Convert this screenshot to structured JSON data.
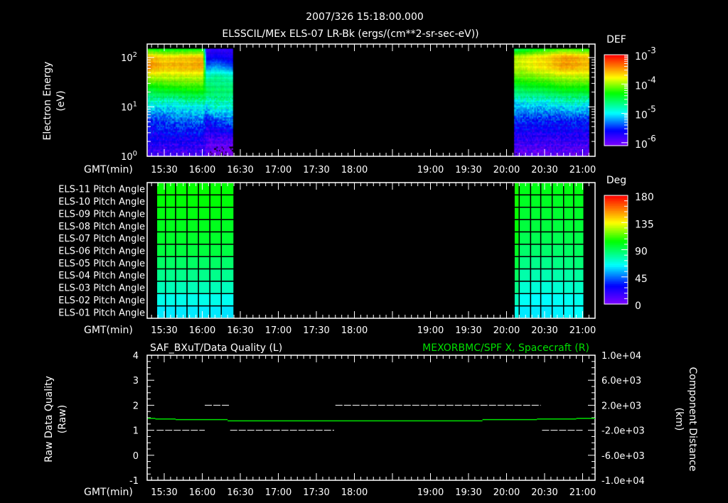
{
  "header": {
    "title": "2007/326 15:18:00.000",
    "subtitle": "ELSSCIL/MEx ELS-07 LR-Bk  (ergs/(cm**2-sr-sec-eV))"
  },
  "colors": {
    "background": "#000000",
    "axes": "#ffffff",
    "spacecraft_x_line": "#00e000",
    "quality_line": "#ffffff"
  },
  "time_axis": {
    "label": "GMT(min)",
    "range": [
      "15:16",
      "21:10"
    ],
    "tick_labels": [
      "15:30",
      "16:00",
      "16:30",
      "17:00",
      "17:30",
      "18:00",
      "19:00",
      "19:30",
      "20:00",
      "20:30",
      "21:00"
    ]
  },
  "chart_data": [
    {
      "type": "heatmap",
      "name": "electron-spectrogram",
      "ylabel": [
        "Electron Energy",
        "(eV)"
      ],
      "yscale": "log",
      "ylim": [
        1,
        190
      ],
      "y_ticks": [
        {
          "base": "10",
          "exp": "2",
          "value": 100
        },
        {
          "base": "10",
          "exp": "1",
          "value": 10
        },
        {
          "base": "10",
          "exp": "0",
          "value": 1
        }
      ],
      "colorbar": {
        "label": "DEF",
        "scale": "log",
        "range_log10": [
          -6.1,
          -3.0
        ],
        "ticks": [
          {
            "base": "10",
            "exp": "-3",
            "value": -3
          },
          {
            "base": "10",
            "exp": "-4",
            "value": -4
          },
          {
            "base": "10",
            "exp": "-5",
            "value": -5
          },
          {
            "base": "10",
            "exp": "-6",
            "value": -6
          }
        ]
      },
      "energy_bins_log10": [
        0,
        0.3,
        0.7,
        1.0,
        1.3,
        1.6,
        1.8,
        2.0,
        2.16
      ],
      "blocks": [
        {
          "start": "15:17",
          "end": "16:24",
          "samples": [
            {
              "time": "15:17",
              "log_def": [
                -5.9,
                -5.7,
                -5.5,
                -5.0,
                -4.5,
                -3.9,
                -3.4,
                -3.6,
                -4.3
              ]
            },
            {
              "time": "15:30",
              "log_def": [
                -5.9,
                -5.7,
                -5.4,
                -5.0,
                -4.4,
                -3.9,
                -3.6,
                -3.7,
                -4.4
              ]
            },
            {
              "time": "16:00",
              "log_def": [
                -5.9,
                -5.7,
                -5.3,
                -4.9,
                -4.3,
                -3.9,
                -3.5,
                -3.6,
                -4.4
              ]
            },
            {
              "time": "16:03",
              "log_def": [
                -6.0,
                -5.9,
                -5.6,
                -5.0,
                -4.5,
                -4.8,
                -5.3,
                -5.7,
                -5.8
              ]
            },
            {
              "time": "16:10",
              "log_def": [
                -6.2,
                -5.9,
                -5.4,
                -4.8,
                -4.6,
                -4.7,
                -5.2,
                -5.6,
                -5.8
              ]
            },
            {
              "time": "16:24",
              "log_def": [
                -6.2,
                -5.9,
                -5.3,
                -4.9,
                -4.6,
                -4.8,
                -5.4,
                -5.7,
                -5.8
              ]
            }
          ]
        },
        {
          "start": "20:06",
          "end": "21:05",
          "samples": [
            {
              "time": "20:06",
              "log_def": [
                -6.0,
                -5.8,
                -5.5,
                -5.1,
                -4.6,
                -4.1,
                -3.9,
                -3.9,
                -4.6
              ]
            },
            {
              "time": "20:30",
              "log_def": [
                -6.0,
                -5.8,
                -5.5,
                -5.1,
                -4.5,
                -4.0,
                -3.7,
                -3.7,
                -4.3
              ]
            },
            {
              "time": "20:45",
              "log_def": [
                -6.0,
                -5.8,
                -5.5,
                -5.0,
                -4.4,
                -3.9,
                -3.5,
                -3.5,
                -4.2
              ]
            },
            {
              "time": "21:05",
              "log_def": [
                -6.0,
                -5.8,
                -5.5,
                -5.0,
                -4.4,
                -3.9,
                -3.6,
                -3.6,
                -4.3
              ]
            }
          ]
        }
      ]
    },
    {
      "type": "heatmap",
      "name": "pitch-angle",
      "rows": [
        "ELS-11 Pitch Angle",
        "ELS-10 Pitch Angle",
        "ELS-09 Pitch Angle",
        "ELS-08 Pitch Angle",
        "ELS-07 Pitch Angle",
        "ELS-06 Pitch Angle",
        "ELS-05 Pitch Angle",
        "ELS-04 Pitch Angle",
        "ELS-03 Pitch Angle",
        "ELS-02 Pitch Angle",
        "ELS-01 Pitch Angle"
      ],
      "colorbar": {
        "label": "Deg",
        "range": [
          0,
          180
        ],
        "ticks": [
          "180",
          "135",
          "90",
          "45",
          "0"
        ]
      },
      "columns": [
        {
          "start": "15:24",
          "end": "15:31",
          "values": [
            105,
            104,
            102,
            100,
            98,
            95,
            89,
            83,
            76,
            68,
            62
          ]
        },
        {
          "start": "15:31",
          "end": "15:39",
          "values": [
            105,
            104,
            102,
            100,
            98,
            95,
            89,
            83,
            76,
            68,
            62
          ]
        },
        {
          "start": "15:39",
          "end": "15:48",
          "values": [
            105,
            104,
            102,
            100,
            98,
            95,
            89,
            83,
            76,
            68,
            62
          ]
        },
        {
          "start": "15:48",
          "end": "15:57",
          "values": [
            105,
            104,
            102,
            100,
            98,
            95,
            89,
            83,
            76,
            68,
            62
          ]
        },
        {
          "start": "15:57",
          "end": "16:06",
          "values": [
            105,
            104,
            102,
            100,
            98,
            95,
            89,
            83,
            76,
            68,
            62
          ]
        },
        {
          "start": "16:06",
          "end": "16:15",
          "values": [
            105,
            104,
            102,
            100,
            98,
            95,
            89,
            83,
            76,
            68,
            62
          ]
        },
        {
          "start": "16:15",
          "end": "16:25",
          "values": [
            104,
            103,
            101,
            99,
            97,
            94,
            88,
            82,
            75,
            67,
            61
          ]
        },
        {
          "start": "20:06",
          "end": "20:10",
          "values": [
            106,
            106,
            105,
            104,
            102,
            99,
            95,
            90,
            84,
            76,
            68
          ]
        },
        {
          "start": "20:10",
          "end": "20:19",
          "values": [
            101,
            99,
            97,
            95,
            92,
            88,
            84,
            78,
            72,
            66,
            62
          ]
        },
        {
          "start": "20:19",
          "end": "20:27",
          "values": [
            101,
            99,
            97,
            95,
            92,
            88,
            83,
            77,
            71,
            65,
            62
          ]
        },
        {
          "start": "20:27",
          "end": "20:36",
          "values": [
            101,
            99,
            97,
            95,
            92,
            88,
            83,
            77,
            71,
            65,
            62
          ]
        },
        {
          "start": "20:36",
          "end": "20:45",
          "values": [
            101,
            99,
            97,
            95,
            92,
            88,
            84,
            78,
            72,
            66,
            63
          ]
        },
        {
          "start": "20:45",
          "end": "20:53",
          "values": [
            102,
            100,
            98,
            96,
            93,
            89,
            85,
            79,
            73,
            67,
            64
          ]
        },
        {
          "start": "20:53",
          "end": "21:01",
          "values": [
            102,
            100,
            98,
            96,
            93,
            90,
            86,
            80,
            74,
            68,
            65
          ]
        }
      ]
    },
    {
      "type": "line",
      "name": "quality-and-position",
      "left_title": "SAF_BXuT/Data Quality (L)",
      "right_title": "MEXORBMC/SPF X, Spacecraft (R)",
      "ylabel_left": [
        "Raw Data Quality",
        "(Raw)"
      ],
      "ylabel_right": [
        "Component Distance",
        "(km)"
      ],
      "ylim_left": [
        -1,
        4
      ],
      "ylim_right": [
        -10000,
        10000
      ],
      "left_ticks": [
        "4",
        "3",
        "2",
        "1",
        "0",
        "-1"
      ],
      "right_ticks": [
        "1.0e+04",
        "6.0e+03",
        "2.0e+03",
        "-2.0e+03",
        "-6.0e+03",
        "-1.0e+04"
      ],
      "series": [
        {
          "name": "Data Quality",
          "axis": "left",
          "style": "dashed",
          "segments": [
            {
              "start": "15:24",
              "end": "16:02",
              "value": 1
            },
            {
              "start": "16:02",
              "end": "16:22",
              "value": 2
            },
            {
              "start": "16:22",
              "end": "17:44",
              "value": 1
            },
            {
              "start": "17:45",
              "end": "20:27",
              "value": 2
            },
            {
              "start": "20:28",
              "end": "21:00",
              "value": 1
            }
          ]
        },
        {
          "name": "Spacecraft X",
          "axis": "right",
          "style": "step",
          "segments": [
            {
              "start": "15:17",
              "end": "15:23",
              "value": -100
            },
            {
              "start": "15:23",
              "end": "15:39",
              "value": -200
            },
            {
              "start": "15:39",
              "end": "16:20",
              "value": -300
            },
            {
              "start": "16:20",
              "end": "19:41",
              "value": -500
            },
            {
              "start": "19:41",
              "end": "20:24",
              "value": -300
            },
            {
              "start": "20:24",
              "end": "20:55",
              "value": -200
            },
            {
              "start": "20:55",
              "end": "21:10",
              "value": -100
            }
          ]
        }
      ]
    }
  ]
}
